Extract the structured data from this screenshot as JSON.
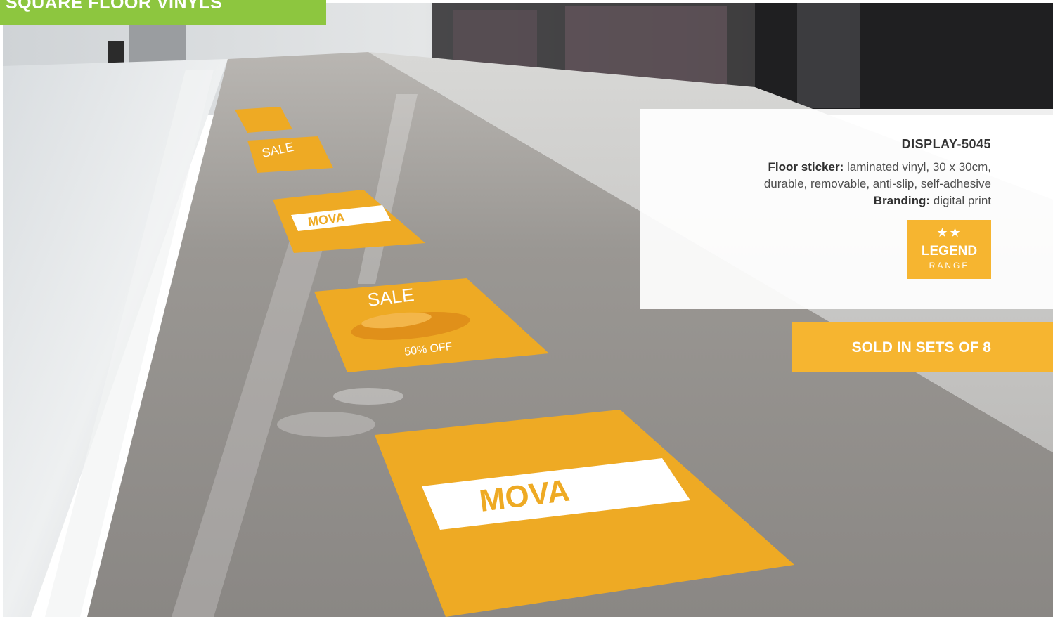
{
  "header": {
    "title": "SQUARE FLOOR VINYLS"
  },
  "product": {
    "code": "DISPLAY-5045",
    "spec_label": "Floor sticker:",
    "spec_text_line1": " laminated vinyl, 30 x 30cm,",
    "spec_text_line2": "durable, removable, anti-slip, self-adhesive",
    "branding_label": "Branding:",
    "branding_text": " digital print"
  },
  "badge": {
    "stars": "★★",
    "name": "LEGEND",
    "range": "RANGE"
  },
  "banner": {
    "label": "SOLD IN SETS OF 8"
  },
  "stickers": {
    "sale": "SALE",
    "discount": "50% OFF",
    "brand": "MOVA"
  },
  "colors": {
    "title_green": "#8dc63f",
    "accent_orange": "#f6b530",
    "sticker_orange": "#eeaa24",
    "floor_grey": "#8e8b87"
  },
  "icons": {
    "badge": "star-icon"
  }
}
